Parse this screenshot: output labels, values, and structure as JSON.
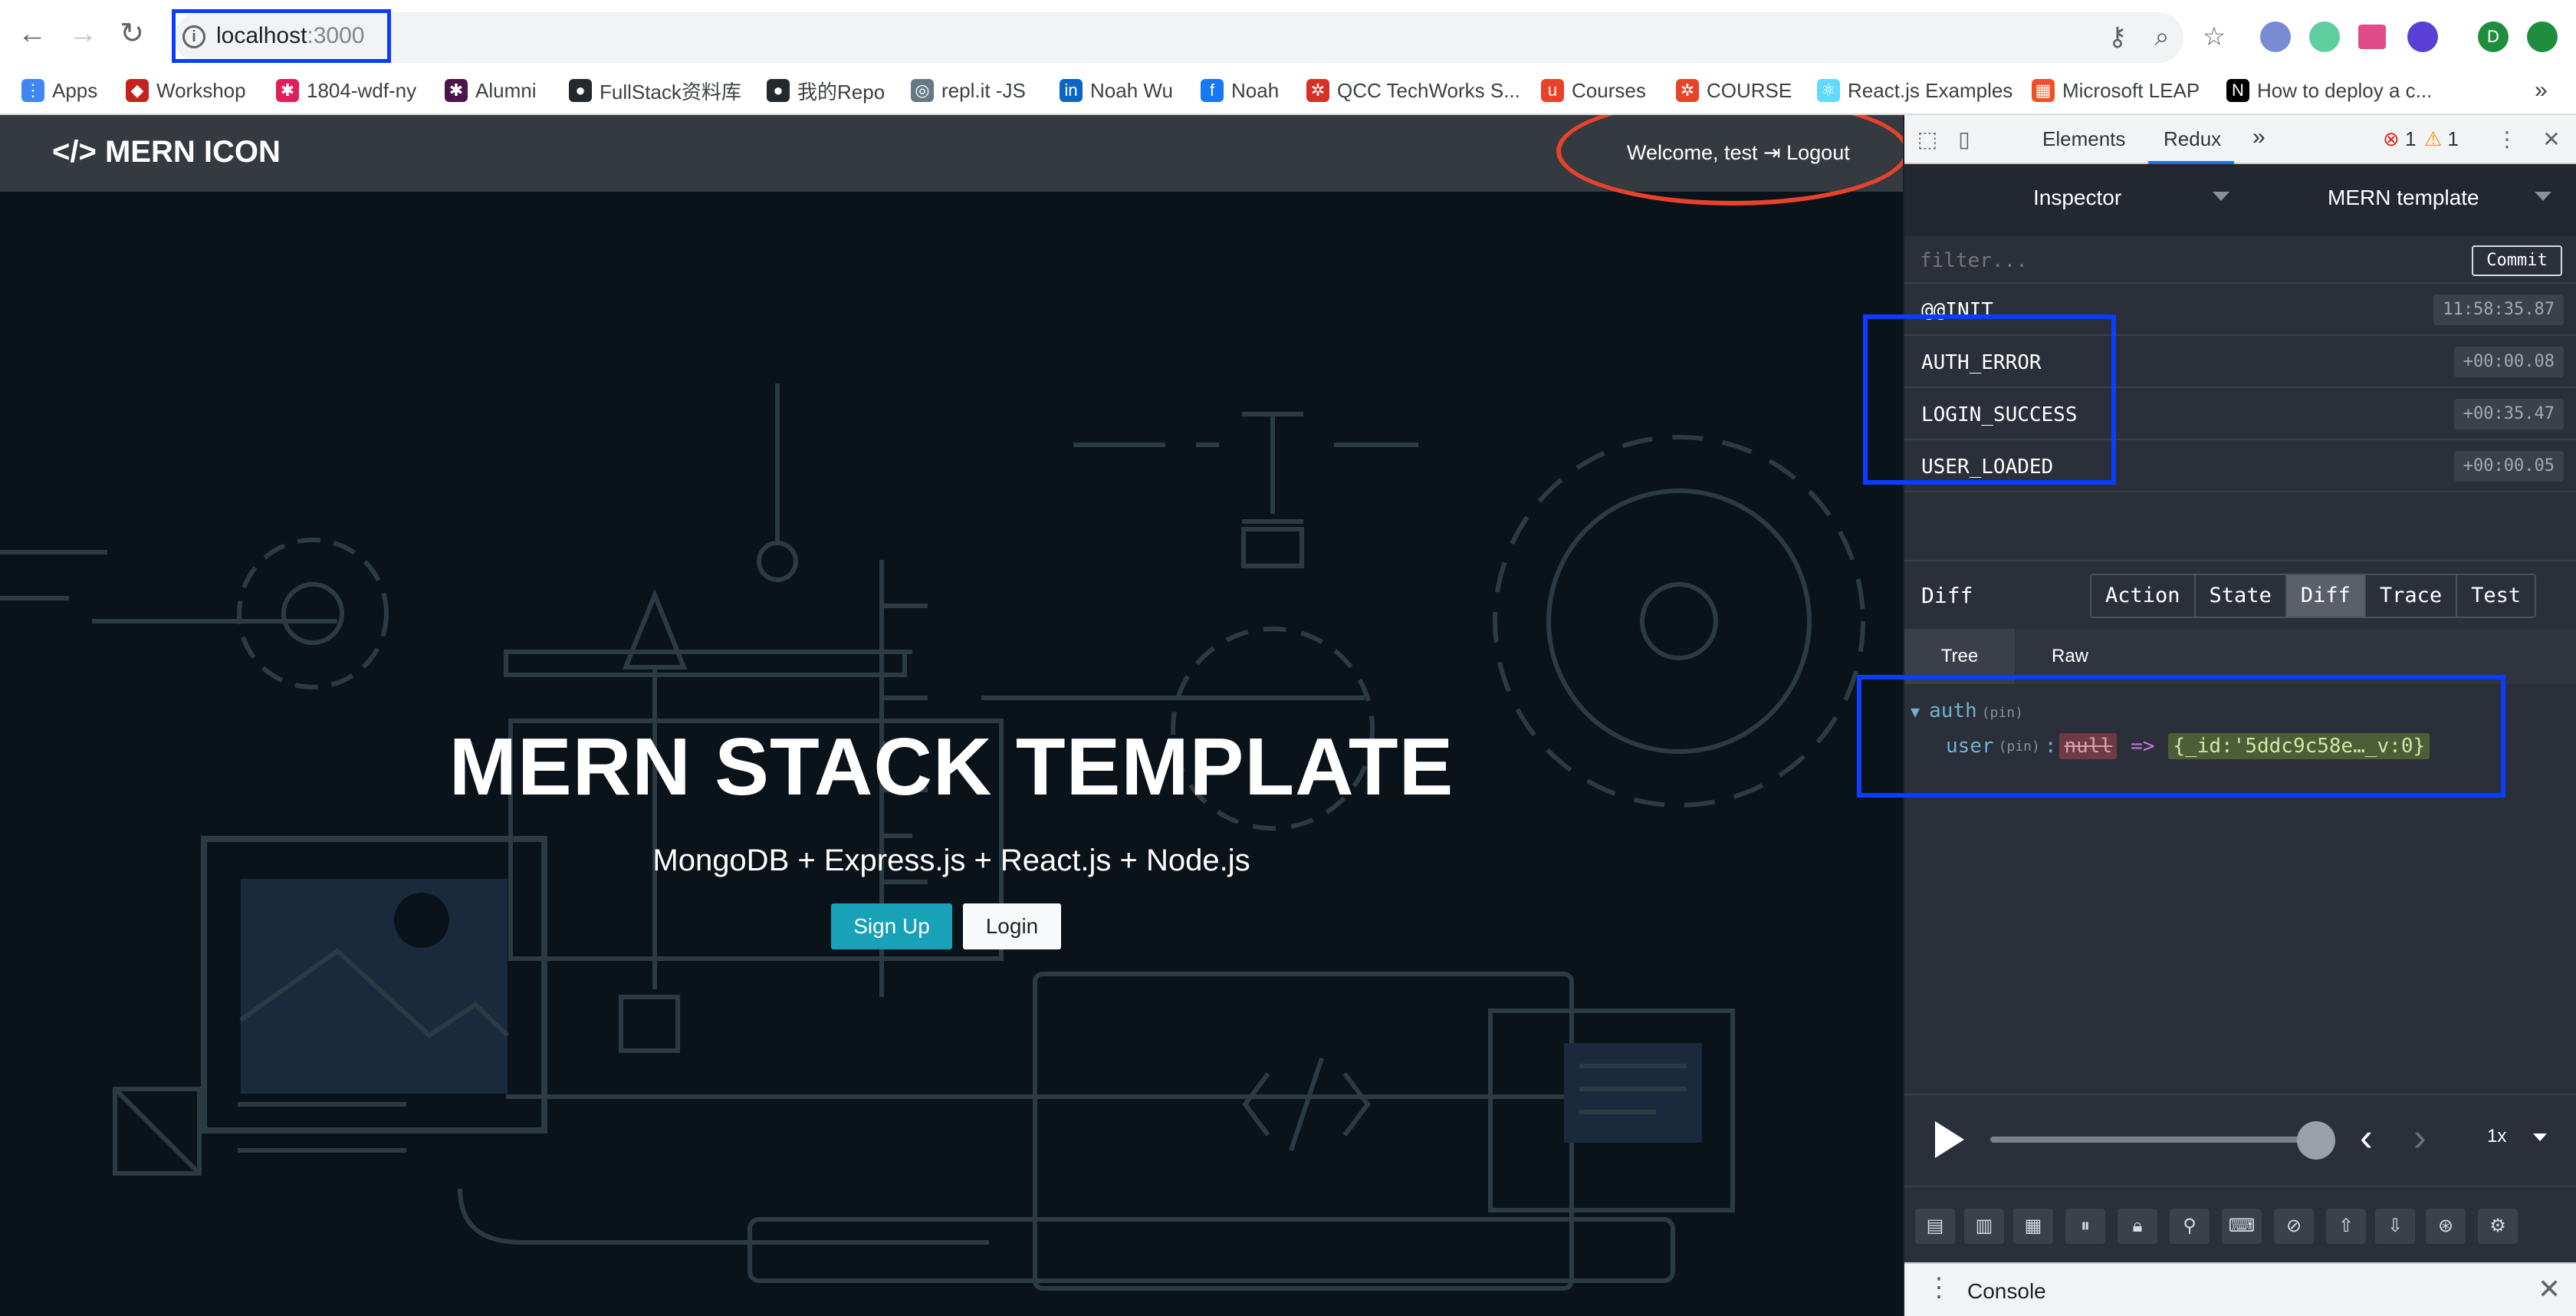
{
  "browser": {
    "url_host": "localhost",
    "url_port": ":3000",
    "bookmarks": [
      {
        "label": "Apps",
        "icon": "apps-grid-icon",
        "color": "#4285f4"
      },
      {
        "label": "Workshop",
        "icon": "workshop-icon",
        "color": "#c5221f"
      },
      {
        "label": "1804-wdf-ny",
        "icon": "slack-icon",
        "color": "#e01e5a"
      },
      {
        "label": "Alumni",
        "icon": "slack-icon",
        "color": "#4a154b"
      },
      {
        "label": "FullStack资料库",
        "icon": "github-icon",
        "color": "#24292e"
      },
      {
        "label": "我的Repo",
        "icon": "github-icon",
        "color": "#24292e"
      },
      {
        "label": "repl.it -JS",
        "icon": "replit-icon",
        "color": "#667881"
      },
      {
        "label": "Noah Wu",
        "icon": "linkedin-icon",
        "color": "#0a66c2"
      },
      {
        "label": "Noah",
        "icon": "facebook-icon",
        "color": "#1877f2"
      },
      {
        "label": "QCC TechWorks S...",
        "icon": "qcc-icon",
        "color": "#d93025"
      },
      {
        "label": "Courses",
        "icon": "courses-icon",
        "color": "#e8432a"
      },
      {
        "label": "COURSE",
        "icon": "course-icon",
        "color": "#e8432a"
      },
      {
        "label": "React.js Examples",
        "icon": "react-icon",
        "color": "#61dafb"
      },
      {
        "label": "Microsoft LEAP",
        "icon": "microsoft-icon",
        "color": "#f25022"
      },
      {
        "label": "How to deploy a c...",
        "icon": "notion-icon",
        "color": "#000000"
      }
    ],
    "more_bookmarks": "»"
  },
  "site": {
    "brand": "</> MERN ICON",
    "welcome": "Welcome, test",
    "logout": "Logout",
    "hero_title": "MERN STACK TEMPLATE",
    "hero_subtitle": "MongoDB + Express.js + React.js + Node.js",
    "signup": "Sign Up",
    "login": "Login"
  },
  "devtools": {
    "tabs": [
      "Elements",
      "Redux"
    ],
    "active_tab": "Redux",
    "more": "»",
    "error_count": "1",
    "warning_count": "1",
    "monitor": "Inspector",
    "store": "MERN template",
    "filter_placeholder": "filter...",
    "commit": "Commit",
    "actions": [
      {
        "name": "@@INIT",
        "time": "11:58:35.87"
      },
      {
        "name": "AUTH_ERROR",
        "time": "+00:00.08"
      },
      {
        "name": "LOGIN_SUCCESS",
        "time": "+00:35.47"
      },
      {
        "name": "USER_LOADED",
        "time": "+00:00.05"
      }
    ],
    "diff_label": "Diff",
    "view_tabs": [
      "Action",
      "State",
      "Diff",
      "Trace",
      "Test"
    ],
    "active_view": "Diff",
    "sub_tabs": [
      "Tree",
      "Raw"
    ],
    "active_sub": "Tree",
    "tree": {
      "key": "auth",
      "child_key": "user",
      "pin": "(pin)",
      "old_value": "null",
      "arrow": "=>",
      "new_value": "{_id:'5ddc9c58e…_v:0}"
    },
    "speed": "1x",
    "console": "Console"
  },
  "colors": {
    "accent_highlight": "#0a3dff",
    "annotation_ellipse": "#e8432a",
    "signup_bg": "#17a2b8"
  }
}
